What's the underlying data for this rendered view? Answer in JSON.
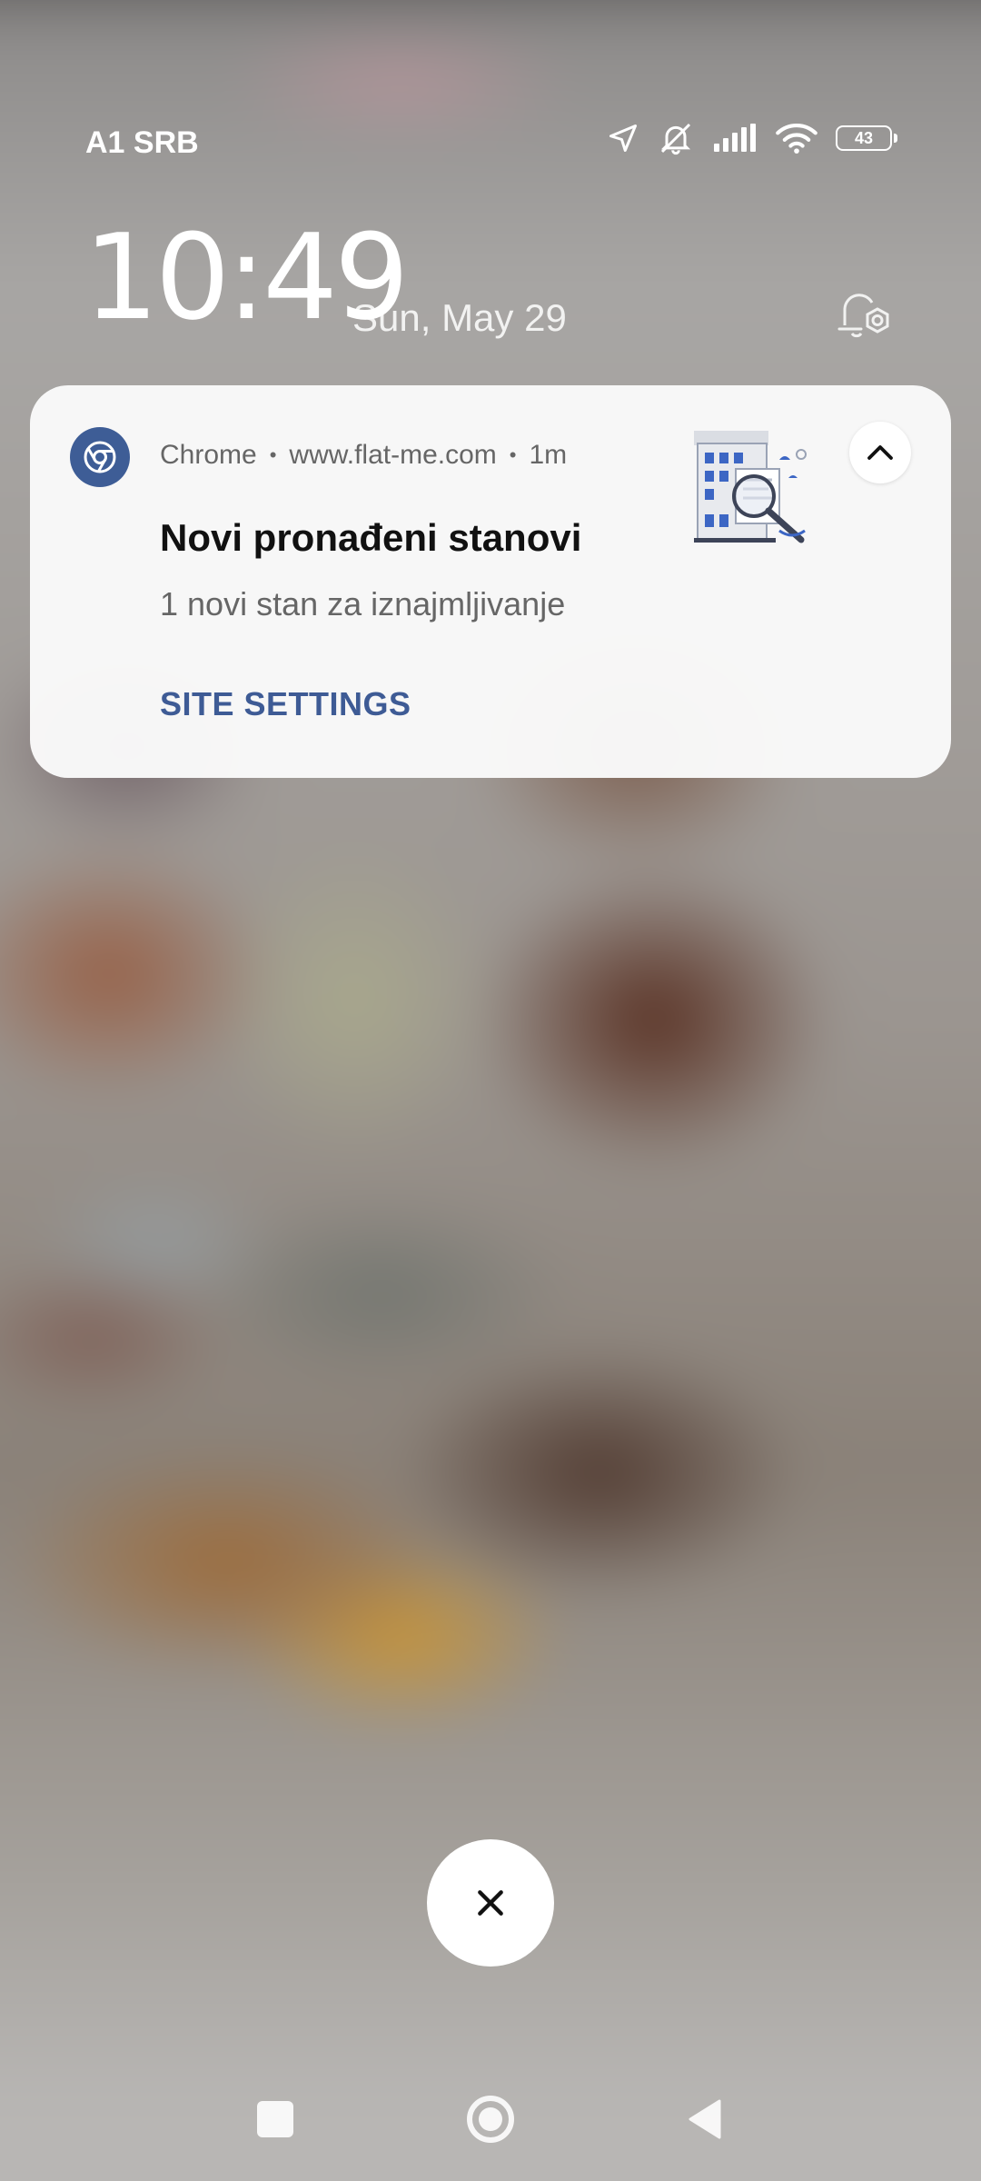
{
  "status_bar": {
    "carrier": "A1 SRB",
    "icons": [
      "location-arrow-icon",
      "vibrate-mute-icon",
      "signal-icon",
      "wifi-icon",
      "battery-icon"
    ],
    "battery_level": "43"
  },
  "lockscreen": {
    "time": "10:49",
    "date": "Sun, May 29",
    "alarm_icon": "alarm-gear-icon"
  },
  "notification": {
    "app_name": "Chrome",
    "source": "www.flat-me.com",
    "separator": "•",
    "time_ago": "1m",
    "title": "Novi pronađeni stanovi",
    "text": "1 novi stan za iznajmljivanje",
    "action_label": "SITE SETTINGS",
    "thumbnail": "building-search-illustration",
    "accent_color": "#3e5b95"
  },
  "dismiss": {
    "icon": "close-icon"
  },
  "nav_bar": {
    "icons": [
      "recents-icon",
      "home-icon",
      "back-icon"
    ]
  }
}
